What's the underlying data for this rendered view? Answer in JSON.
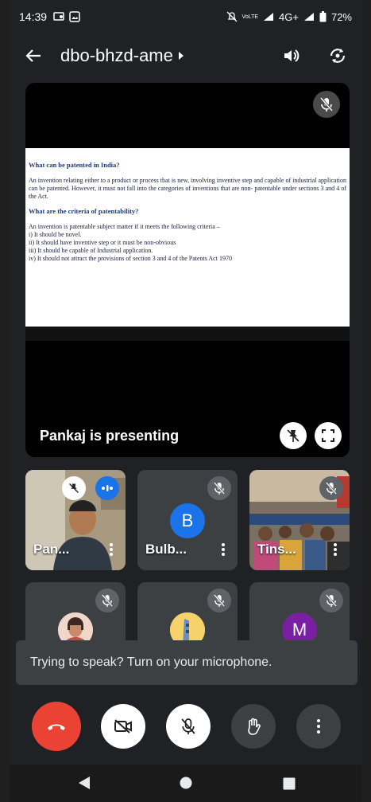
{
  "status": {
    "time": "14:39",
    "network": "4G+",
    "volte": "VoLTE",
    "battery": "72%"
  },
  "meeting": {
    "code": "dbo-bhzd-ame"
  },
  "presentation": {
    "presenter_label": "Pankaj is presenting",
    "slide": {
      "heading1": "What can be patented in India?",
      "para1": "An invention relating either to a product or process that is new, involving inventive step and capable of industrial application can be patented. However, it must not fall into the categories of inventions that are non- patentable under sections 3 and 4 of the Act.",
      "heading2": "What are the criteria of patentability?",
      "para2": "An invention is patentable subject matter if it meets the following criteria –",
      "criteria": [
        "i)    It should be novel.",
        "ii)   It should have inventive step or it must be non-obvious",
        "iii)  It should be capable of Industrial application.",
        "iv)  It should not attract the provisions of section 3 and 4 of the Patents Act 1970"
      ]
    }
  },
  "participants": [
    {
      "name": "Pan...",
      "kind": "video"
    },
    {
      "name": "Bulb...",
      "kind": "avatar",
      "initial": "B",
      "color": "#1a73e8"
    },
    {
      "name": "Tins...",
      "kind": "video"
    },
    {
      "name": "",
      "kind": "photo"
    },
    {
      "name": "",
      "kind": "photo"
    },
    {
      "name": "",
      "kind": "avatar",
      "initial": "M",
      "color": "#7b1fa2"
    }
  ],
  "toast": {
    "text": "Trying to speak? Turn on your microphone."
  },
  "colors": {
    "end_call": "#ea4335",
    "background": "#202124",
    "tile": "#3c4043"
  }
}
